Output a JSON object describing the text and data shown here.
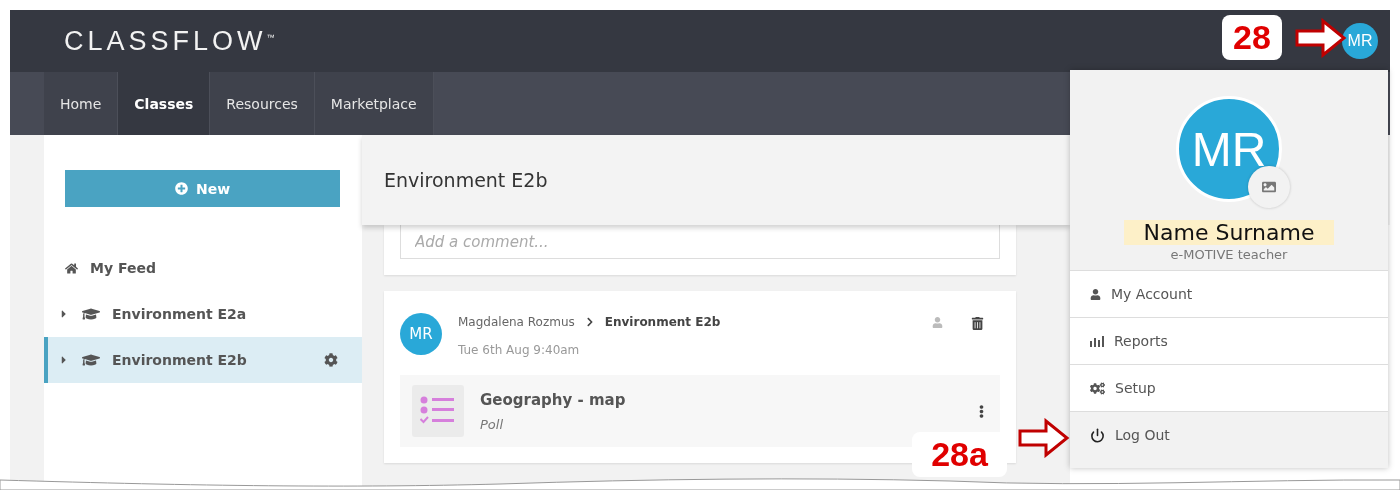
{
  "app": {
    "logo": "CLASSFLOW",
    "logo_mark": "™"
  },
  "nav": [
    {
      "label": "Home",
      "selected": false
    },
    {
      "label": "Classes",
      "selected": true
    },
    {
      "label": "Resources",
      "selected": false
    },
    {
      "label": "Marketplace",
      "selected": false
    }
  ],
  "user_avatar": "MR",
  "sidebar": {
    "new_button": "New",
    "items": [
      {
        "label": "My Feed",
        "kind": "feed",
        "selected": false
      },
      {
        "label": "Environment E2a",
        "kind": "class",
        "selected": false
      },
      {
        "label": "Environment E2b",
        "kind": "class",
        "selected": true
      }
    ]
  },
  "main": {
    "title": "Environment E2b",
    "comment_placeholder": "Add a comment...",
    "post": {
      "avatar": "MR",
      "author": "Magdalena Rozmus",
      "class": "Environment E2b",
      "time": "Tue 6th Aug 9:40am",
      "item": {
        "title": "Geography - map",
        "type": "Poll"
      }
    }
  },
  "profile_menu": {
    "avatar": "MR",
    "name": "Name Surname",
    "role": "e-MOTIVE teacher",
    "items": [
      {
        "label": "My Account",
        "kind": "account",
        "highlighted": false
      },
      {
        "label": "Reports",
        "kind": "reports",
        "highlighted": false
      },
      {
        "label": "Setup",
        "kind": "setup",
        "highlighted": false
      },
      {
        "label": "Log Out",
        "kind": "logout",
        "highlighted": true
      }
    ]
  },
  "annotations": [
    {
      "label": "28"
    },
    {
      "label": "28a"
    }
  ]
}
